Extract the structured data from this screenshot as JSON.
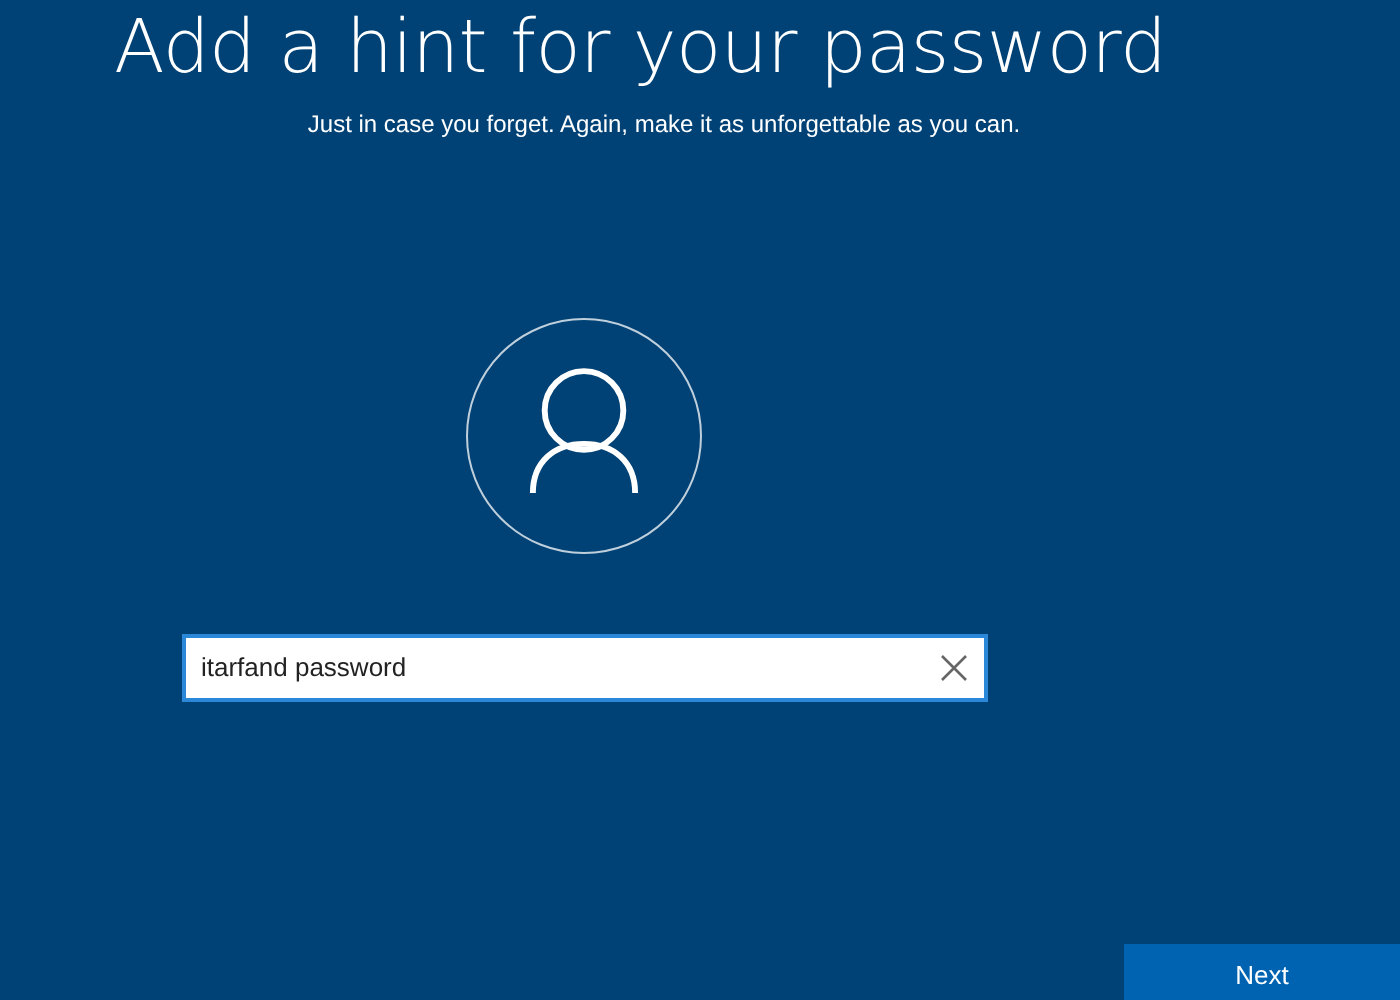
{
  "title": "Add a hint for your password",
  "subtitle": "Just in case you forget. Again, make it as unforgettable as you can.",
  "hint_field": {
    "value": "itarfand password",
    "focused": true
  },
  "buttons": [
    "Next"
  ]
}
